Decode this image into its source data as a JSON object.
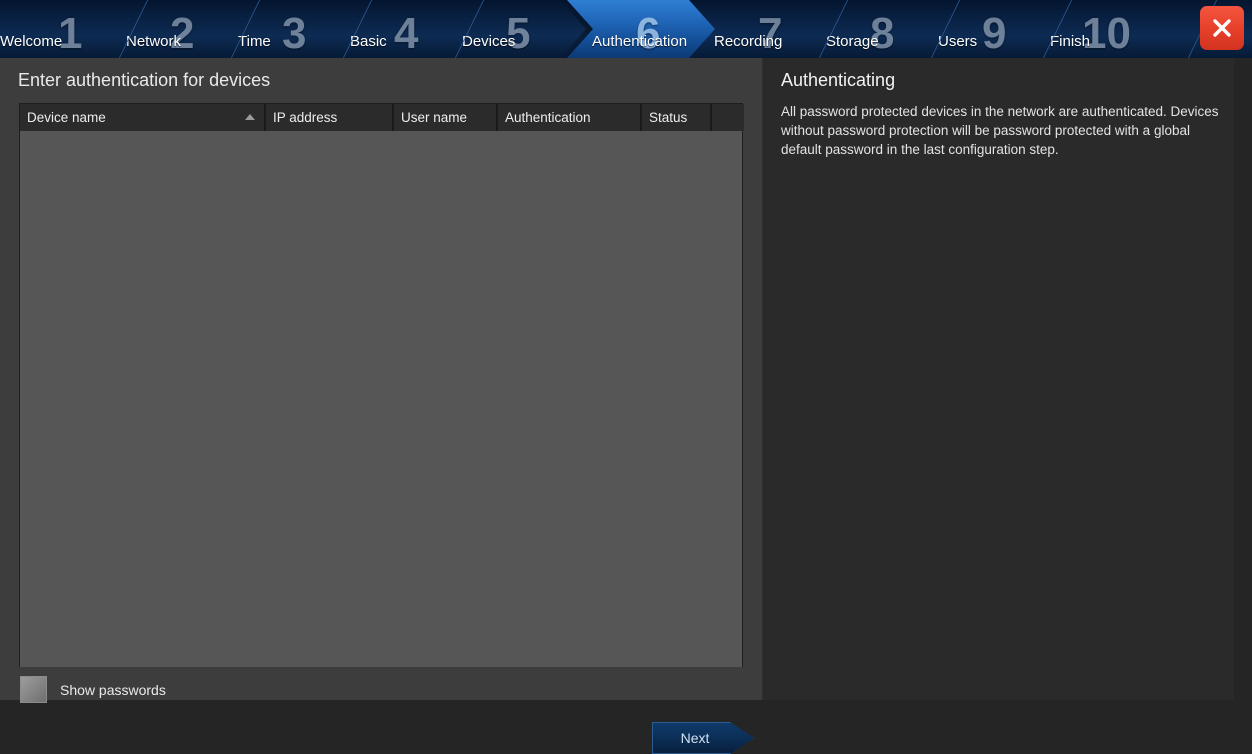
{
  "wizard": {
    "tabs": [
      {
        "num": "1",
        "label": "Welcome",
        "active": false
      },
      {
        "num": "2",
        "label": "Network",
        "active": false
      },
      {
        "num": "3",
        "label": "Time",
        "active": false
      },
      {
        "num": "4",
        "label": "Basic",
        "active": false
      },
      {
        "num": "5",
        "label": "Devices",
        "active": false
      },
      {
        "num": "6",
        "label": "Authentication",
        "active": true
      },
      {
        "num": "7",
        "label": "Recording",
        "active": false
      },
      {
        "num": "8",
        "label": "Storage",
        "active": false
      },
      {
        "num": "9",
        "label": "Users",
        "active": false
      },
      {
        "num": "10",
        "label": "Finish",
        "active": false
      }
    ],
    "close_icon": "close-icon",
    "accent_active": "#2f7fd4",
    "close_color": "#e8412c"
  },
  "left": {
    "title": "Enter authentication for devices",
    "table": {
      "columns": [
        {
          "label": "Device name",
          "sorted": "asc"
        },
        {
          "label": "IP address",
          "sorted": ""
        },
        {
          "label": "User name",
          "sorted": ""
        },
        {
          "label": "Authentication",
          "sorted": ""
        },
        {
          "label": "Status",
          "sorted": ""
        },
        {
          "label": "",
          "sorted": ""
        }
      ],
      "rows": []
    },
    "show_passwords_label": "Show passwords",
    "show_passwords_checked": false,
    "next_label": "Next"
  },
  "right": {
    "title": "Authenticating",
    "body": "All password protected devices in the network are authenticated. Devices without password protection will be password protected with a global default password in the last configuration step."
  }
}
